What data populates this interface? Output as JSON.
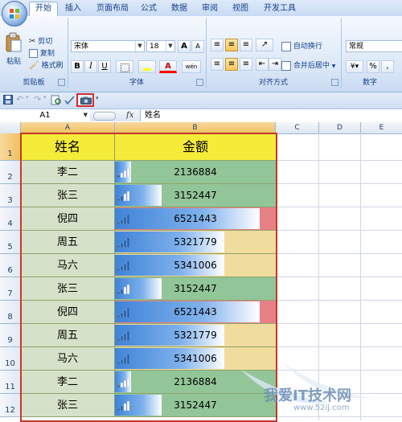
{
  "ribbon": {
    "tabs": [
      {
        "label": "开始",
        "active": true
      },
      {
        "label": "插入",
        "active": false
      },
      {
        "label": "页面布局",
        "active": false
      },
      {
        "label": "公式",
        "active": false
      },
      {
        "label": "数据",
        "active": false
      },
      {
        "label": "审阅",
        "active": false
      },
      {
        "label": "视图",
        "active": false
      },
      {
        "label": "开发工具",
        "active": false
      }
    ],
    "clipboard": {
      "paste": "粘贴",
      "cut": "剪切",
      "copy": "复制",
      "format_painter": "格式刷",
      "label": "剪贴板"
    },
    "font": {
      "name": "宋体",
      "size": "18",
      "grow": "A",
      "shrink": "A",
      "bold": "B",
      "italic": "I",
      "underline": "U",
      "font_color_letter": "A",
      "phonetic": "wén",
      "label": "字体"
    },
    "alignment": {
      "wrap": "自动换行",
      "merge": "合并后居中",
      "label": "对齐方式"
    },
    "number": {
      "format": "常规",
      "percent": "%",
      "comma": ",",
      "label": "数字"
    }
  },
  "formula_bar": {
    "name_box": "A1",
    "fx": "fx",
    "value": "姓名"
  },
  "columns": [
    "A",
    "B",
    "C",
    "D",
    "E"
  ],
  "table": {
    "header": {
      "name": "姓名",
      "amount": "金额"
    },
    "rows": [
      {
        "row": "2",
        "name": "李二",
        "amount": "2136884",
        "bar": 0.1,
        "color": "#92c598"
      },
      {
        "row": "3",
        "name": "张三",
        "amount": "3152447",
        "bar": 0.29,
        "color": "#92c598"
      },
      {
        "row": "4",
        "name": "倪四",
        "amount": "6521443",
        "bar": 0.9,
        "color": "#e77f86"
      },
      {
        "row": "5",
        "name": "周五",
        "amount": "5321779",
        "bar": 0.68,
        "color": "#f0dc9c"
      },
      {
        "row": "6",
        "name": "马六",
        "amount": "5341006",
        "bar": 0.68,
        "color": "#f0dc9c"
      },
      {
        "row": "7",
        "name": "张三",
        "amount": "3152447",
        "bar": 0.29,
        "color": "#92c598"
      },
      {
        "row": "8",
        "name": "倪四",
        "amount": "6521443",
        "bar": 0.9,
        "color": "#e77f86"
      },
      {
        "row": "9",
        "name": "周五",
        "amount": "5321779",
        "bar": 0.68,
        "color": "#f0dc9c"
      },
      {
        "row": "10",
        "name": "马六",
        "amount": "5341006",
        "bar": 0.68,
        "color": "#f0dc9c"
      },
      {
        "row": "11",
        "name": "李二",
        "amount": "2136884",
        "bar": 0.1,
        "color": "#92c598"
      },
      {
        "row": "12",
        "name": "张三",
        "amount": "3152447",
        "bar": 0.29,
        "color": "#92c598"
      }
    ]
  },
  "colors": {
    "header_fill": "#f5ec3a",
    "name_fill": "#d6e1c9",
    "selection": "#c0392b"
  },
  "watermark": {
    "text": "我爱IT技术网",
    "url": "www.52ij.com"
  }
}
